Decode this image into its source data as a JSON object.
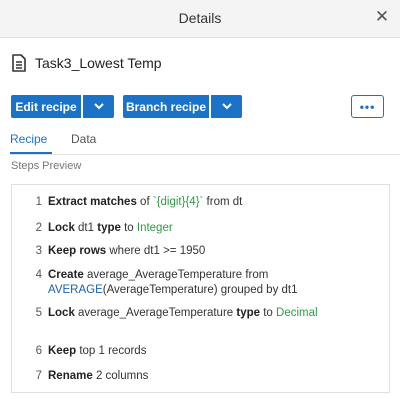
{
  "panel": {
    "title": "Details"
  },
  "document": {
    "name": "Task3_Lowest Temp"
  },
  "actions": {
    "edit_label": "Edit recipe",
    "branch_label": "Branch recipe",
    "more_label": "•••"
  },
  "tabs": [
    {
      "label": "Recipe",
      "active": true
    },
    {
      "label": "Data",
      "active": false
    }
  ],
  "steps_preview_label": "Steps Preview",
  "steps": [
    {
      "num": "1",
      "parts": [
        {
          "t": "Extract matches",
          "s": "kw"
        },
        {
          "t": " of ",
          "s": ""
        },
        {
          "t": "`{digit}{4}`",
          "s": "green"
        },
        {
          "t": " from dt",
          "s": ""
        }
      ]
    },
    {
      "num": "2",
      "parts": [
        {
          "t": "Lock",
          "s": "kw"
        },
        {
          "t": " dt1 ",
          "s": ""
        },
        {
          "t": "type",
          "s": "kw"
        },
        {
          "t": " to ",
          "s": ""
        },
        {
          "t": "Integer",
          "s": "green"
        }
      ]
    },
    {
      "num": "3",
      "parts": [
        {
          "t": "Keep rows",
          "s": "kw"
        },
        {
          "t": " where dt1 >= 1950",
          "s": ""
        }
      ]
    },
    {
      "num": "4",
      "parts": [
        {
          "t": "Create",
          "s": "kw"
        },
        {
          "t": " average_AverageTemperature from ",
          "s": ""
        },
        {
          "t": "AVERAGE",
          "s": "blue"
        },
        {
          "t": "(AverageTemperature) grouped by dt1",
          "s": ""
        }
      ]
    },
    {
      "num": "5",
      "parts": [
        {
          "t": "Lock",
          "s": "kw"
        },
        {
          "t": " average_AverageTemperature ",
          "s": ""
        },
        {
          "t": "type",
          "s": "kw"
        },
        {
          "t": " to ",
          "s": ""
        },
        {
          "t": "Decimal",
          "s": "green"
        }
      ]
    },
    {
      "num": "6",
      "parts": [
        {
          "t": "Keep",
          "s": "kw"
        },
        {
          "t": " top 1 records",
          "s": ""
        }
      ]
    },
    {
      "num": "7",
      "parts": [
        {
          "t": "Rename",
          "s": "kw"
        },
        {
          "t": " 2 columns",
          "s": ""
        }
      ]
    }
  ],
  "colors": {
    "accent": "#1a73c7",
    "keyword_green": "#2e9b45",
    "function_blue": "#1a5fb4"
  },
  "icons": {
    "close": "close-icon",
    "document": "document-icon",
    "caret": "chevron-down-icon",
    "more": "more-horizontal-icon"
  }
}
